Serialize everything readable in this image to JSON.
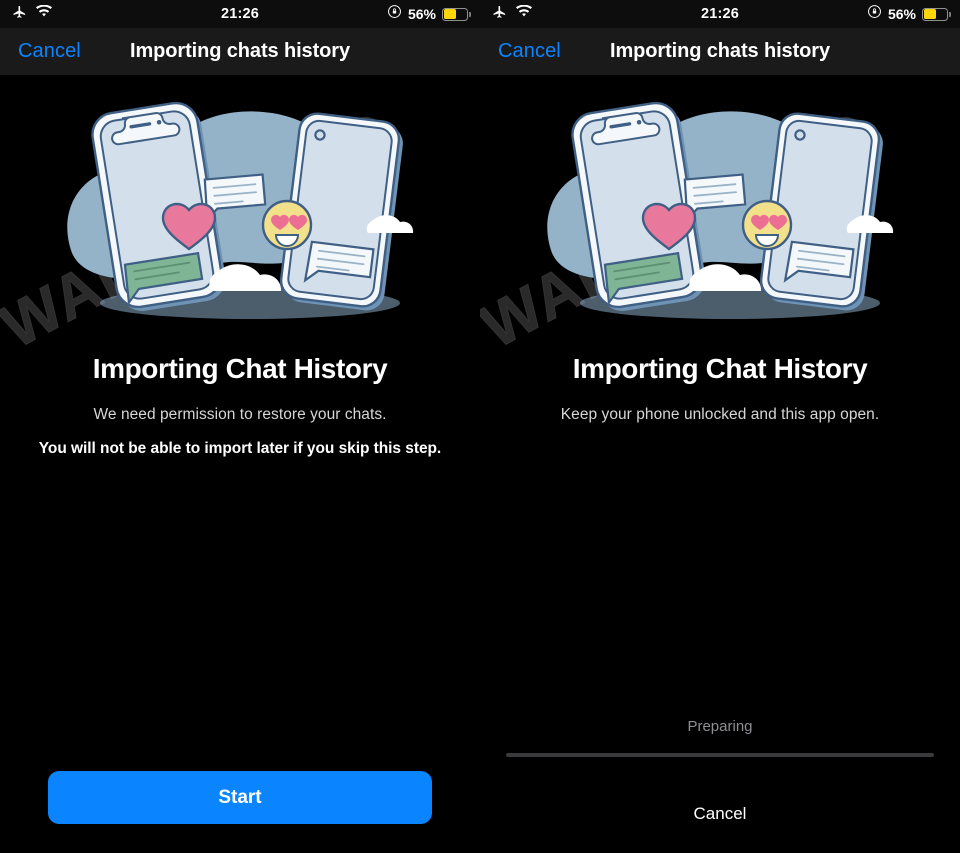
{
  "status_bar": {
    "airplane_icon": "airplane-icon",
    "wifi_icon": "wifi-icon",
    "time": "21:26",
    "rotation_lock_icon": "rotation-lock-icon",
    "battery_percent": "56%",
    "battery_level": 56,
    "battery_color": "#ffd60a"
  },
  "nav": {
    "cancel_label": "Cancel",
    "title": "Importing chats history",
    "accent_color": "#0a84ff"
  },
  "watermark": {
    "text": "WABETAINFO"
  },
  "illustration": {
    "name": "two-phones-chat-sync-illustration",
    "blob_color": "#94b3c9",
    "phone_body_color": "#f4f8fb",
    "phone_screen_color": "#d3e0ec",
    "outline_color": "#3f5f84",
    "shadow_color": "#6e93b4",
    "heart_color": "#e8799c",
    "emoji_color": "#f2e08a",
    "green_bubble_color": "#7fb494",
    "cloud_color": "#ffffff"
  },
  "screens": [
    {
      "id": "permission-screen",
      "title": "Importing Chat History",
      "subtitle": "We need permission to restore your chats.",
      "warning": "You will not be able to import later if you skip this step.",
      "primary_button": "Start",
      "has_progress": false
    },
    {
      "id": "progress-screen",
      "title": "Importing Chat History",
      "subtitle": "Keep your phone unlocked and this app open.",
      "warning": "",
      "progress_label": "Preparing",
      "progress_percent": 0,
      "cancel_button": "Cancel",
      "has_progress": true
    }
  ]
}
